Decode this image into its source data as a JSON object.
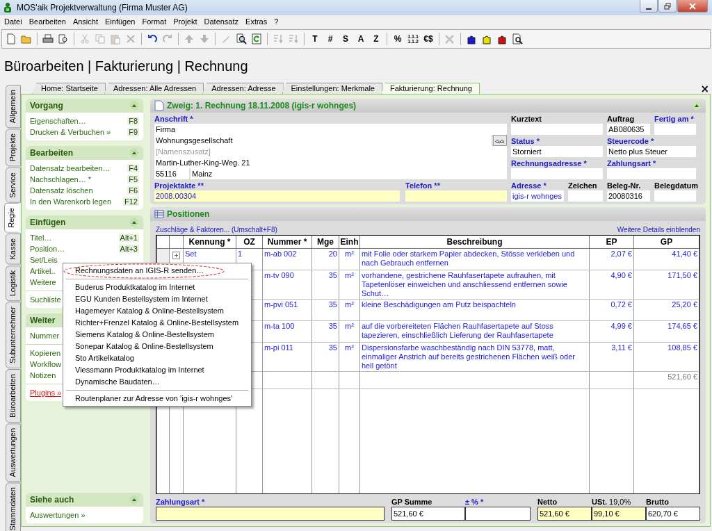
{
  "window": {
    "title": "MOS'aik Projektverwaltung (Firma Muster AG)"
  },
  "menu": [
    "Datei",
    "Bearbeiten",
    "Ansicht",
    "Einfügen",
    "Format",
    "Projekt",
    "Datensatz",
    "Extras",
    "?"
  ],
  "toolbar": [
    {
      "items": [
        {
          "kind": "new",
          "disabled": false
        },
        {
          "kind": "open",
          "disabled": false
        }
      ]
    },
    {
      "items": [
        {
          "kind": "print",
          "disabled": false
        },
        {
          "kind": "preview",
          "disabled": false
        }
      ]
    },
    {
      "items": [
        {
          "kind": "cut",
          "disabled": true
        },
        {
          "kind": "copy",
          "disabled": true
        },
        {
          "kind": "paste",
          "disabled": true
        },
        {
          "kind": "delete",
          "disabled": true
        }
      ]
    },
    {
      "items": [
        {
          "kind": "undo",
          "disabled": false
        },
        {
          "kind": "redo",
          "disabled": true
        }
      ]
    },
    {
      "items": [
        {
          "kind": "up",
          "disabled": true
        },
        {
          "kind": "down",
          "disabled": true
        }
      ]
    },
    {
      "items": [
        {
          "kind": "edit",
          "disabled": true
        },
        {
          "kind": "find",
          "disabled": false
        },
        {
          "kind": "refresh",
          "disabled": false
        }
      ]
    },
    {
      "items": [
        {
          "kind": "sortasc",
          "disabled": true
        },
        {
          "kind": "sortdesc",
          "disabled": true
        }
      ]
    },
    {
      "items": [
        {
          "kind": "text",
          "text": "T",
          "disabled": false
        },
        {
          "kind": "text",
          "text": "#",
          "disabled": false
        },
        {
          "kind": "text",
          "text": "S",
          "disabled": false
        },
        {
          "kind": "text",
          "text": "A",
          "disabled": false
        },
        {
          "kind": "text",
          "text": "Z",
          "disabled": false
        }
      ]
    },
    {
      "items": [
        {
          "kind": "text",
          "text": "%",
          "disabled": false
        },
        {
          "kind": "stack",
          "lines": [
            "1.1.1",
            "1.1.2"
          ],
          "disabled": false
        },
        {
          "kind": "text",
          "text": "€$",
          "disabled": false
        }
      ]
    },
    {
      "items": [
        {
          "kind": "tool",
          "disabled": true
        }
      ]
    },
    {
      "items": [
        {
          "kind": "puzzle",
          "color": "#1a1ad0",
          "disabled": false
        },
        {
          "kind": "puzzle",
          "color": "#e8e000",
          "disabled": false
        },
        {
          "kind": "puzzle",
          "color": "#d01010",
          "disabled": false
        },
        {
          "kind": "docfind",
          "disabled": false
        }
      ]
    }
  ],
  "heading": "Büroarbeiten | Fakturierung | Rechnung",
  "side_tabs": [
    {
      "label": "Allgemein",
      "selected": false
    },
    {
      "label": "Projekte",
      "selected": false
    },
    {
      "label": "Service",
      "selected": false
    },
    {
      "label": "Regie",
      "selected": true
    },
    {
      "label": "Kasse",
      "selected": false
    },
    {
      "label": "Logistik",
      "selected": false
    },
    {
      "label": "Subunternehmer",
      "selected": false
    },
    {
      "label": "Büroarbeiten",
      "selected": false
    },
    {
      "label": "Auswertungen",
      "selected": false
    },
    {
      "label": "Stammdaten",
      "selected": false
    }
  ],
  "tabs": [
    {
      "label": "Home: Startseite",
      "selected": false
    },
    {
      "label": "Adressen: Alle Adressen",
      "selected": false
    },
    {
      "label": "Adressen: Adresse",
      "selected": false
    },
    {
      "label": "Einstellungen: Merkmale",
      "selected": false
    },
    {
      "label": "Fakturierung: Rechnung",
      "selected": true
    }
  ],
  "close_tab": "×",
  "sidebar": [
    {
      "title": "Vorgang",
      "expanded": true,
      "groups": [
        [
          {
            "label": "Eigenschaften…",
            "key": "F8",
            "kind": "action"
          },
          {
            "label": "Drucken & Verbuchen »",
            "key": "F9",
            "kind": "action"
          }
        ]
      ]
    },
    {
      "title": "Bearbeiten",
      "expanded": true,
      "groups": [
        [
          {
            "label": "Datensatz bearbeiten…",
            "key": "F4",
            "kind": "action"
          },
          {
            "label": "Nachschlagen… *",
            "key": "F5",
            "kind": "action"
          },
          {
            "label": "Datensatz löschen",
            "key": "F6",
            "kind": "action"
          },
          {
            "label": "In den Warenkorb legen",
            "key": "F12",
            "kind": "action"
          }
        ]
      ]
    },
    {
      "title": "Einfügen",
      "expanded": true,
      "groups": [
        [
          {
            "label": "Titel…",
            "key": "Alt+1",
            "kind": "action"
          },
          {
            "label": "Position…",
            "key": "Alt+3",
            "kind": "action"
          },
          {
            "label": "Set/Leis",
            "kind": "action"
          },
          {
            "label": "Artikel..",
            "kind": "action"
          },
          {
            "label": "Weitere",
            "kind": "action"
          }
        ],
        [
          {
            "label": "Suchliste",
            "kind": "action"
          }
        ]
      ]
    },
    {
      "title": "Weiter",
      "groups": [
        [
          {
            "label": "Nummer",
            "kind": "action"
          }
        ],
        [
          {
            "label": "Kopieren",
            "kind": "action"
          },
          {
            "label": "Workflow",
            "kind": "action"
          },
          {
            "label": "Notizen",
            "kind": "action"
          }
        ],
        [
          {
            "label": "Plugins »",
            "kind": "plugin"
          }
        ]
      ]
    },
    {
      "title": "Siehe auch",
      "expanded": true,
      "groups": [
        [
          {
            "label": "Auswertungen »",
            "kind": "action"
          }
        ]
      ]
    }
  ],
  "invoice": {
    "title": "Zweig: 1. Rechnung 18.11.2008 (igis-r wohnges)",
    "expanded": true,
    "address": {
      "label": "Anschrift *",
      "required": true,
      "lines": [
        {
          "kind": "text",
          "value": "Firma"
        },
        {
          "kind": "lookup",
          "value": "Wohnungsgesellschaft"
        },
        {
          "kind": "text",
          "placeholder": "[Namenszusatz]"
        },
        {
          "kind": "text",
          "value": "Martin-Luther-King-Weg. 21"
        }
      ],
      "zip": "55116",
      "city": "Mainz"
    },
    "project": {
      "label": "Projektakte **",
      "required": true,
      "value": "2008.00304",
      "linked": true,
      "highlighted": true
    },
    "phone": {
      "label": "Telefon **",
      "required": true,
      "highlighted": true
    },
    "details": [
      [
        {
          "label": "Kurztext",
          "required": false
        },
        {
          "label": "Auftrag",
          "required": false,
          "value": "AB080635"
        },
        {
          "label": "Fertig am *",
          "required": true
        }
      ],
      [
        {
          "label": "Status *",
          "required": true,
          "value": "Storniert"
        },
        {
          "label": "Steuercode *",
          "required": true,
          "value": "Netto plus Steuer"
        }
      ],
      [
        {
          "label": "Rechnungsadresse *",
          "required": true
        },
        {
          "label": "Zahlungsart *",
          "required": true
        }
      ],
      [
        {
          "label": "Adresse *",
          "required": true,
          "value": "igis-r wohnges",
          "linked": true
        },
        {
          "label": "Zeichen",
          "required": false
        },
        {
          "label": "Beleg-Nr.",
          "required": false,
          "value": "20080316"
        },
        {
          "label": "Belegdatum",
          "required": false
        }
      ]
    ]
  },
  "positions": {
    "title": "Positionen",
    "surcharges_link": "Zuschläge & Faktoren... (Umschalt+F8)",
    "details_link": "Weitere Details einblenden",
    "columns": [
      "Kennung *",
      "OZ",
      "Nummer *",
      "Mge",
      "Einh",
      "Beschreibung",
      "EP",
      "GP"
    ],
    "rows": [
      {
        "expandable": true,
        "kennung": "Set",
        "oz": "1",
        "nummer": "m-ab 002",
        "mge": "20",
        "einh": "m²",
        "beschreibung": "mit Folie oder starkem Papier abdecken, Stösse verkleben und nach Gebrauch entfernen",
        "ep": "2,07 €",
        "gp": "41,40 €"
      },
      {
        "nummer": "m-tv 090",
        "mge": "35",
        "einh": "m²",
        "beschreibung": "vorhandene, gestrichene Rauhfasertapete aufrauhen, mit Tapetenlöser einweichen und anschliessend entfernen sowie Schut…",
        "ep": "4,90 €",
        "gp": "171,50 €"
      },
      {
        "nummer": "m-pvi 051",
        "mge": "35",
        "einh": "m²",
        "beschreibung": "kleine Beschädigungen am Putz beispachteln",
        "ep": "0,72 €",
        "gp": "25,20 €"
      },
      {
        "nummer": "m-ta 100",
        "mge": "35",
        "einh": "m²",
        "beschreibung": "auf die vorbereiteten Flächen Rauhfasertapete auf Stoss tapezieren, einschließlich Lieferung der Rauhfasertapete",
        "ep": "4,99 €",
        "gp": "174,65 €"
      },
      {
        "nummer": "m-pi 011",
        "mge": "35",
        "einh": "m²",
        "beschreibung": "Dispersionsfarbe waschbeständig nach DIN 53778, matt, einmaliger Anstrich auf bereits gestrichenen Flächen weiß oder hell getönt",
        "ep": "3,11 €",
        "gp": "108,85 €"
      }
    ],
    "total": "521,60 €"
  },
  "footer": {
    "payment": {
      "label": "Zahlungsart *",
      "required": true,
      "highlighted": true
    },
    "gp_sum": {
      "label": "GP Summe",
      "required": false,
      "value": "521,60 €",
      "highlighted": false
    },
    "percent": {
      "label": "± % *",
      "required": true,
      "highlighted": false
    },
    "net": {
      "label": "Netto",
      "required": false,
      "value": "521,60 €",
      "highlighted": true
    },
    "vat": {
      "label": "**USt.** 19,0%",
      "required": false,
      "value": "99,10 €",
      "highlighted": true
    },
    "gross": {
      "label": "Brutto",
      "required": false,
      "value": "620,70 €",
      "highlighted": false
    }
  },
  "context_menu": {
    "groups": [
      [
        {
          "label": "Rechnungsdaten an IGIS-R senden…",
          "circled": true
        }
      ],
      [
        {
          "label": "Buderus Produktkatalog im Internet",
          "circled": false
        },
        {
          "label": "EGU Kunden Bestellsystem im Internet",
          "circled": false
        },
        {
          "label": "Hagemeyer Katalog & Online-Bestellsystem",
          "circled": false
        },
        {
          "label": "Richter+Frenzel Katalog & Online-Bestellsystem",
          "circled": false
        },
        {
          "label": "Siemens Katalog & Online-Bestellsystem",
          "circled": false
        },
        {
          "label": "Sonepar Katalog & Online-Bestellsystem",
          "circled": false
        },
        {
          "label": "Sto Artikelkatalog",
          "circled": false
        },
        {
          "label": "Viessmann Produktkatalog im Internet",
          "circled": false
        },
        {
          "label": "Dynamische Baudaten…",
          "circled": false
        }
      ],
      [
        {
          "label": "Routenplaner zur Adresse von 'igis-r wohnges'",
          "circled": false
        }
      ]
    ]
  }
}
